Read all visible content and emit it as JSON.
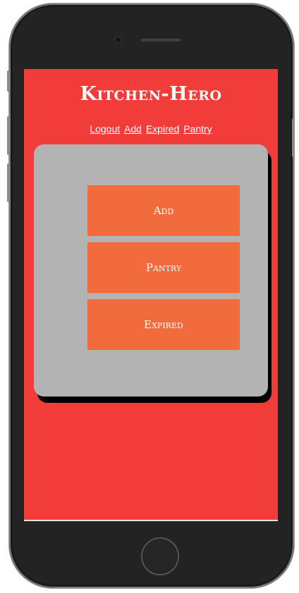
{
  "app": {
    "title": "Kitchen-Hero"
  },
  "nav": {
    "links": [
      "Logout",
      "Add",
      "Expired",
      "Pantry"
    ]
  },
  "menu": {
    "buttons": [
      "Add",
      "Pantry",
      "Expired"
    ]
  },
  "colors": {
    "background": "#f23c3a",
    "panel": "#b3b3b3",
    "button": "#f26b3c",
    "text": "#ffffff"
  }
}
